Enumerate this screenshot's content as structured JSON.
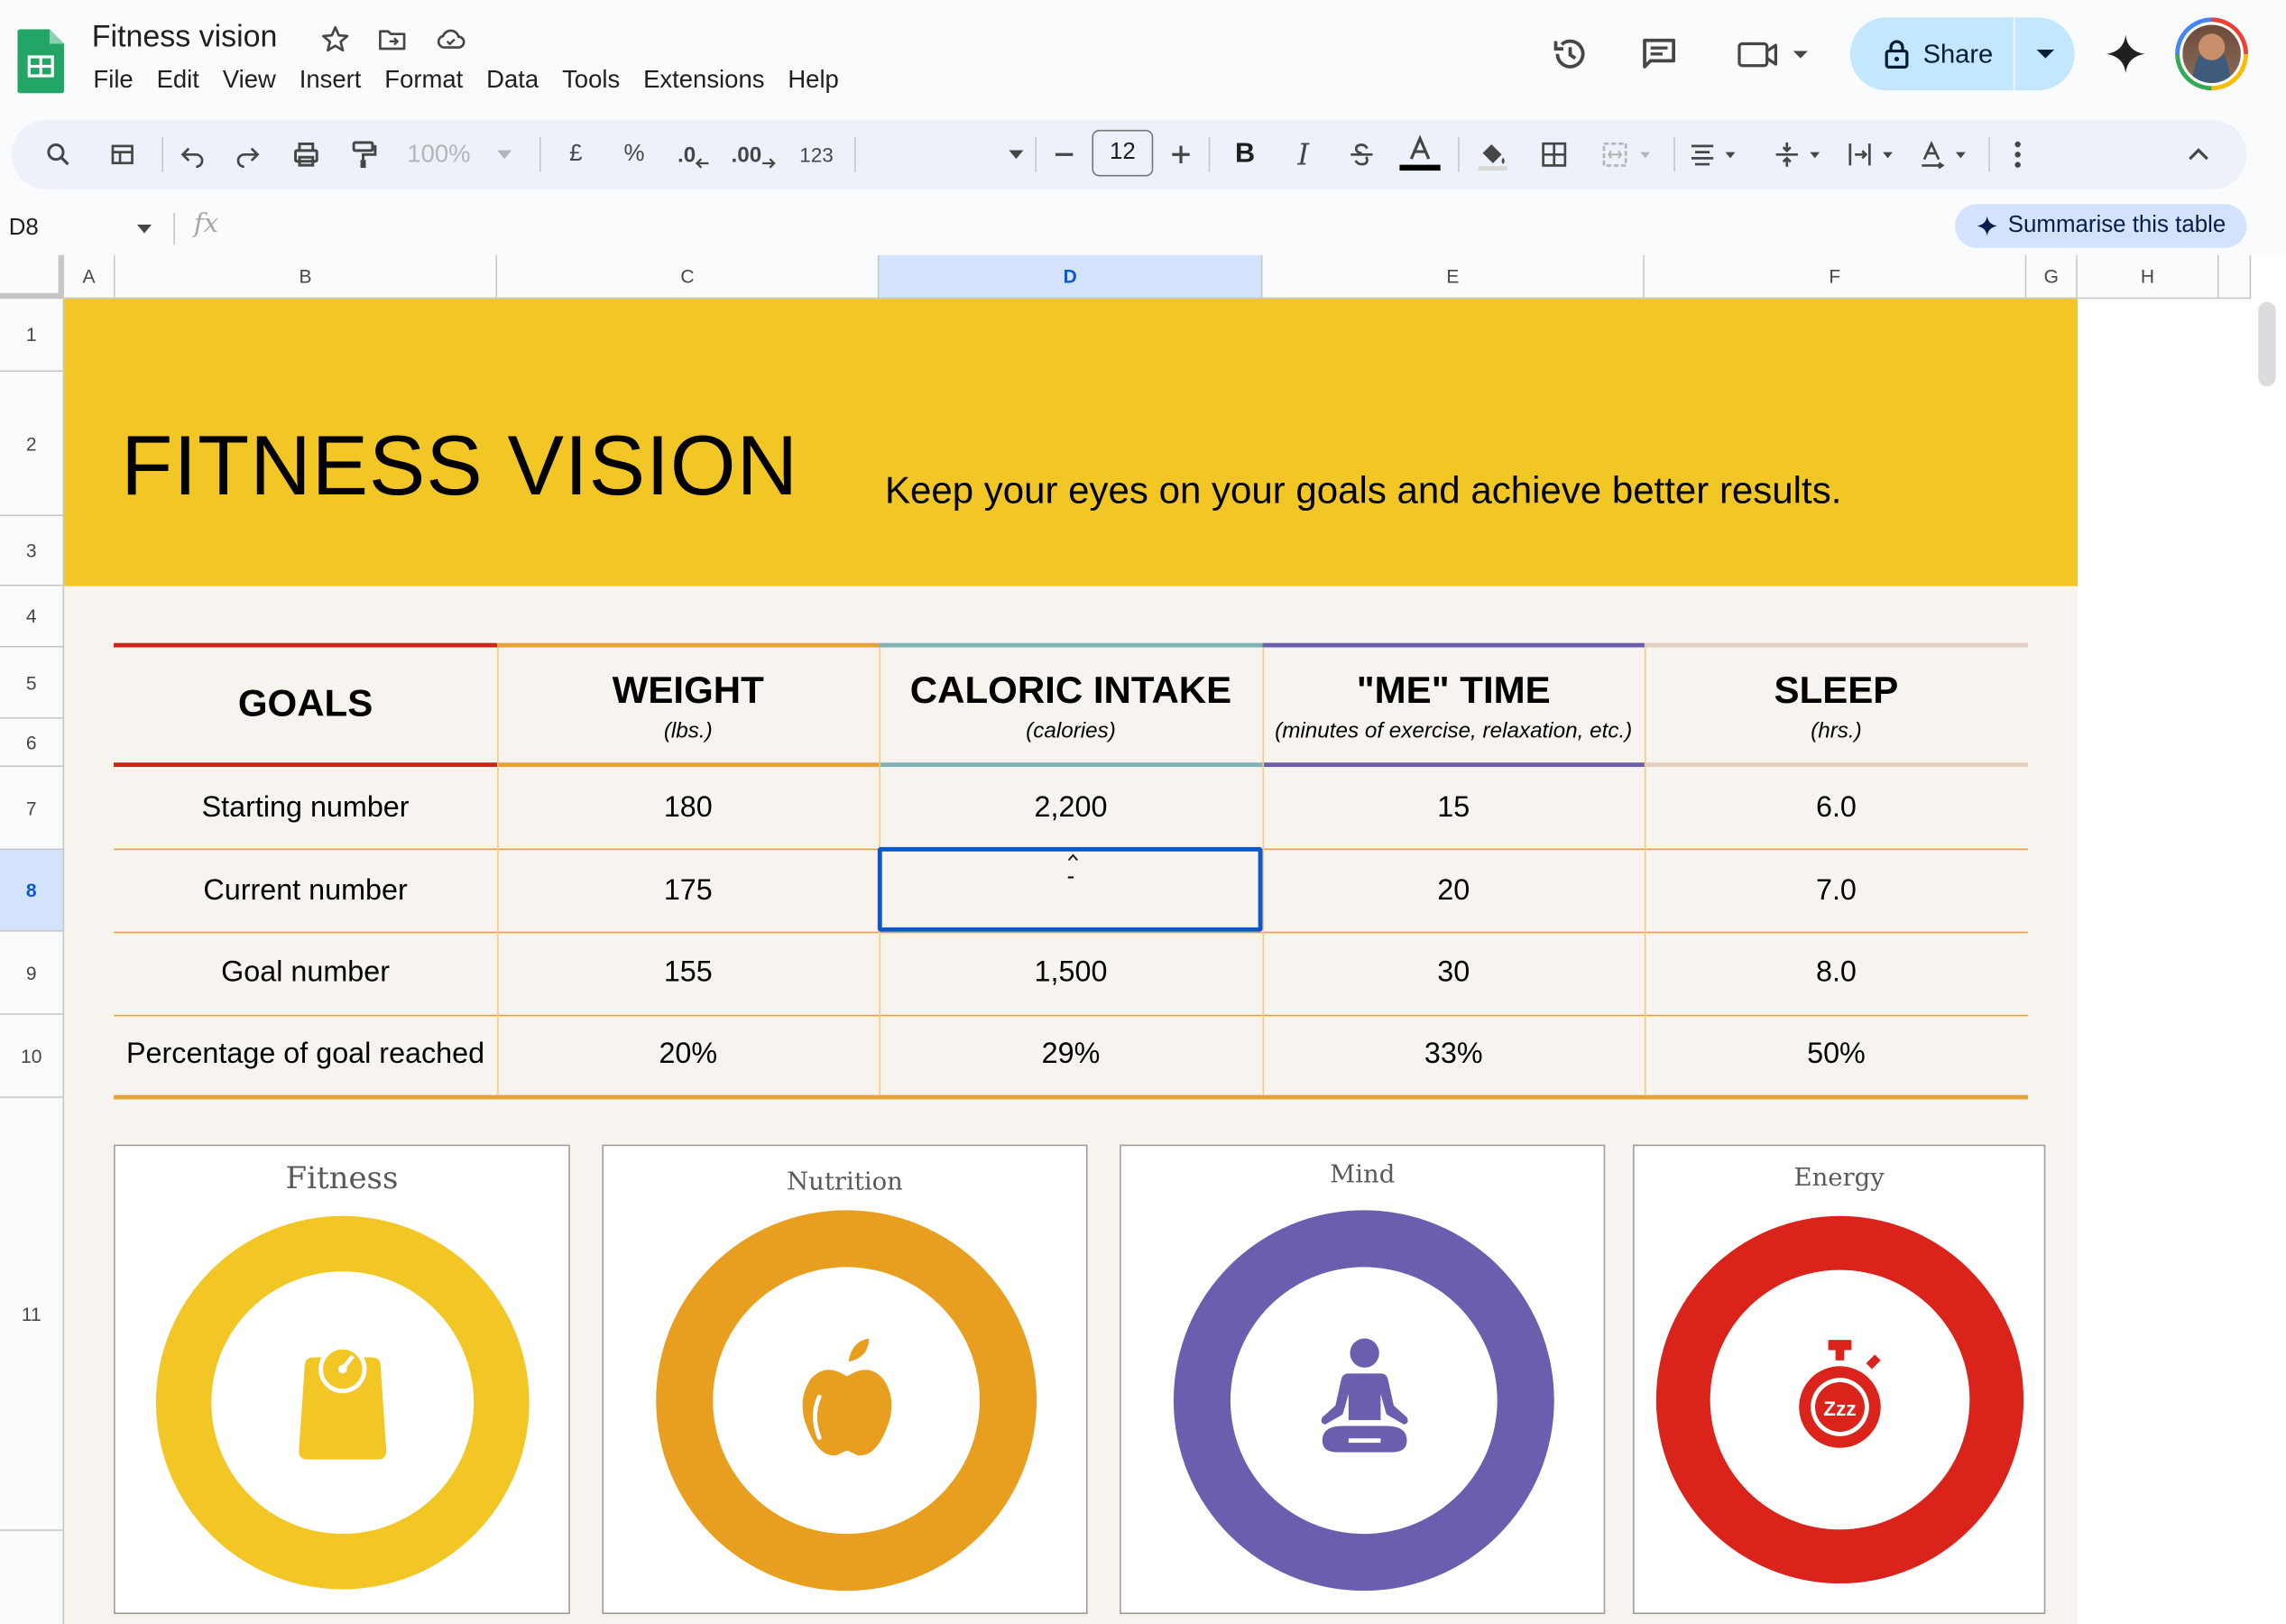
{
  "app": {
    "title": "Fitness vision",
    "menu": [
      "File",
      "Edit",
      "View",
      "Insert",
      "Format",
      "Data",
      "Tools",
      "Extensions",
      "Help"
    ],
    "share_label": "Share"
  },
  "toolbar": {
    "zoom": "100%",
    "currency": "£",
    "percent": "%",
    "dec_decrease": ".0",
    "dec_increase": ".00",
    "number_format": "123",
    "font_size": "12"
  },
  "formula_bar": {
    "cell_ref": "D8",
    "fx": "fx",
    "summarise_label": "Summarise this table"
  },
  "columns": [
    "A",
    "B",
    "C",
    "D",
    "E",
    "F",
    "G",
    "H"
  ],
  "rows": [
    "1",
    "2",
    "3",
    "4",
    "5",
    "6",
    "7",
    "8",
    "9",
    "10",
    "11"
  ],
  "selected_cell": "D8",
  "banner": {
    "title": "FITNESS VISION",
    "subtitle": "Keep your eyes on your goals and achieve better results."
  },
  "table": {
    "headers": [
      {
        "title": "GOALS",
        "sub": ""
      },
      {
        "title": "WEIGHT",
        "sub": "(lbs.)"
      },
      {
        "title": "CALORIC INTAKE",
        "sub": "(calories)"
      },
      {
        "title": "\"ME\" TIME",
        "sub": "(minutes of exercise, relaxation, etc.)"
      },
      {
        "title": "SLEEP",
        "sub": "(hrs.)"
      }
    ],
    "header_colors": [
      "#c9261d",
      "#e5a23a",
      "#7fb3b5",
      "#6a5fa8",
      "#e3cfc0"
    ],
    "rows": [
      [
        "Starting number",
        "180",
        "2,200",
        "15",
        "6.0"
      ],
      [
        "Current number",
        "175",
        "-",
        "20",
        "7.0"
      ],
      [
        "Goal number",
        "155",
        "1,500",
        "30",
        "8.0"
      ],
      [
        "Percentage of goal reached",
        "20%",
        "29%",
        "33%",
        "50%"
      ]
    ]
  },
  "cards": [
    {
      "title": "Fitness",
      "color": "#f2c624",
      "icon": "scale-icon"
    },
    {
      "title": "Nutrition",
      "color": "#e89e1f",
      "icon": "apple-icon"
    },
    {
      "title": "Mind",
      "color": "#6a5fae",
      "icon": "meditation-icon"
    },
    {
      "title": "Energy",
      "color": "#da231a",
      "icon": "stopwatch-icon"
    }
  ]
}
